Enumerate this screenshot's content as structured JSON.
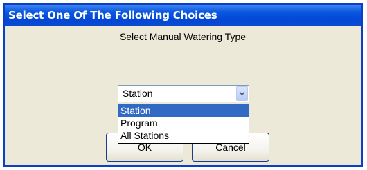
{
  "dialog": {
    "title": "Select One Of The Following Choices",
    "prompt": "Select Manual Watering Type"
  },
  "dropdown": {
    "selected": "Station",
    "options": [
      "Station",
      "Program",
      "All Stations"
    ],
    "highlighted_index": 0,
    "arrow_icon": "chevron-down-icon"
  },
  "buttons": {
    "ok_label": "OK",
    "cancel_label": "Cancel"
  },
  "colors": {
    "title_bar": "#0a58e0",
    "dialog_bg": "#ece9d8",
    "selection": "#316ac5"
  }
}
